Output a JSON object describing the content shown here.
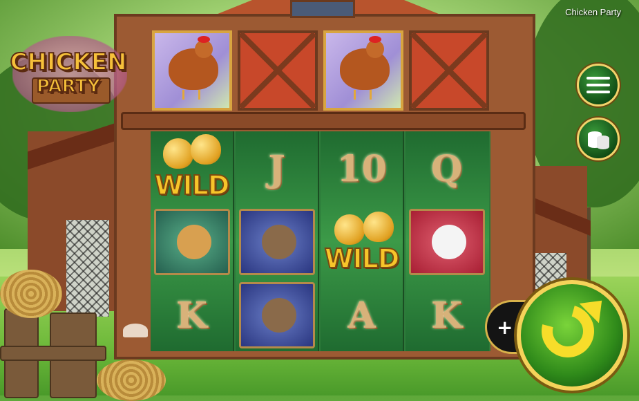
{
  "game_title": "Chicken Party",
  "logo": {
    "line1": "CHICKEN",
    "line2": "PARTY"
  },
  "top_row": [
    {
      "symbol": "hen",
      "icon": "brown-hen-icon"
    },
    {
      "symbol": "barn-door",
      "icon": "barn-door-icon"
    },
    {
      "symbol": "hen",
      "icon": "brown-hen-icon"
    },
    {
      "symbol": "barn-door",
      "icon": "barn-door-icon"
    }
  ],
  "reels": [
    [
      "WILD",
      "buff-hen",
      "K"
    ],
    [
      "J",
      "rooster",
      "rooster"
    ],
    [
      "10",
      "WILD",
      "A"
    ],
    [
      "Q",
      "white-rooster",
      "K"
    ]
  ],
  "wild_label": "WILD",
  "letters": {
    "J": "J",
    "ten": "10",
    "Q": "Q",
    "K": "K",
    "A": "A"
  },
  "buttons": {
    "menu_icon": "hamburger-menu-icon",
    "bet_icon": "coin-stack-icon",
    "plus": "+",
    "spin_icon": "spin-arrow-icon"
  },
  "colors": {
    "accent": "#f5d35a",
    "spin_green": "#2f8a1a",
    "wild_gold": "#f7c52a"
  }
}
